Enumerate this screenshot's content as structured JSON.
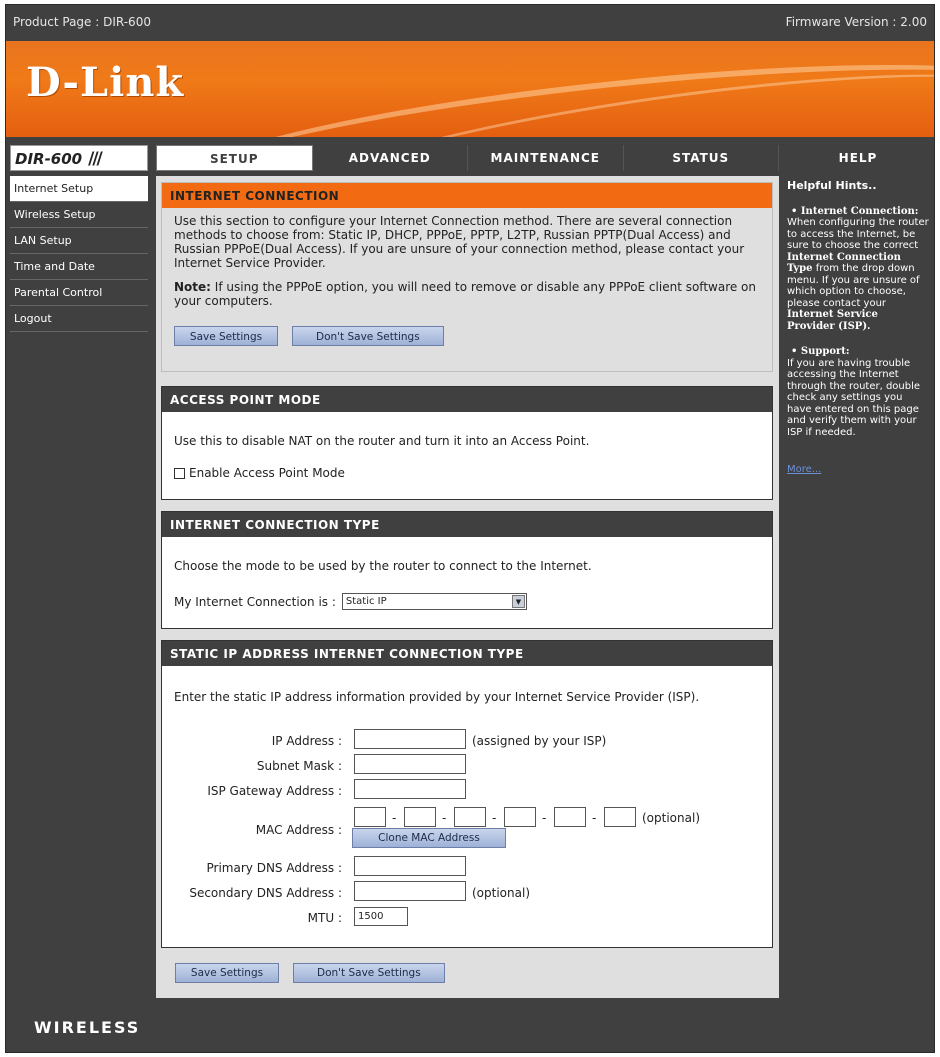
{
  "topbar": {
    "product": "Product Page : DIR-600",
    "firmware": "Firmware Version : 2.00"
  },
  "brand": {
    "logo": "D-Link",
    "model": "DIR-600",
    "model_slashes": "///",
    "footer": "WIRELESS"
  },
  "tabs": [
    "SETUP",
    "ADVANCED",
    "MAINTENANCE",
    "STATUS"
  ],
  "help_tab": "HELP",
  "sidebar": [
    "Internet Setup",
    "Wireless Setup",
    "LAN Setup",
    "Time and Date",
    "Parental Control",
    "Logout"
  ],
  "internet_connection": {
    "title": "INTERNET CONNECTION",
    "desc": "Use this section to configure your Internet Connection method. There are several connection methods to choose from: Static IP, DHCP, PPPoE, PPTP, L2TP, Russian PPTP(Dual Access) and Russian PPPoE(Dual Access). If you are unsure of your connection method, please contact your Internet Service Provider.",
    "note_label": "Note:",
    "note_text": "If using the PPPoE option, you will need to remove or disable any PPPoE client software on your computers."
  },
  "buttons": {
    "save": "Save Settings",
    "dont_save": "Don't Save Settings",
    "clone_mac": "Clone MAC Address"
  },
  "ap_mode": {
    "title": "ACCESS POINT MODE",
    "desc": "Use this to disable NAT on the router and turn it into an Access Point.",
    "checkbox_label": "Enable Access Point Mode"
  },
  "conn_type": {
    "title": "INTERNET CONNECTION TYPE",
    "desc": "Choose the mode to be used by the router to connect to the Internet.",
    "label": "My Internet Connection is :",
    "selected": "Static IP"
  },
  "static_ip": {
    "title": "STATIC IP ADDRESS INTERNET CONNECTION TYPE",
    "desc": "Enter the static IP address information provided by your Internet Service Provider (ISP).",
    "ip_label": "IP Address :",
    "ip_hint": "(assigned by your ISP)",
    "subnet_label": "Subnet Mask :",
    "gateway_label": "ISP Gateway Address :",
    "mac_label": "MAC Address :",
    "mac_sep": "-",
    "mac_hint": "(optional)",
    "dns1_label": "Primary DNS Address :",
    "dns2_label": "Secondary DNS Address :",
    "dns2_hint": "(optional)",
    "mtu_label": "MTU :",
    "mtu_value": "1500"
  },
  "help": {
    "heading": "Helpful Hints..",
    "ic_title": "• Internet Connection:",
    "ic_text1": "When configuring the router to access the Internet, be sure to choose the correct",
    "ic_bold1": "Internet Connection Type",
    "ic_text2": "from the drop down menu. If you are unsure of which option to choose, please contact your",
    "ic_bold2": "Internet Service Provider (ISP).",
    "sup_title": "• Support:",
    "sup_text": "If you are having trouble accessing the Internet through the router, double check any settings you have entered on this page and verify them with your ISP if needed.",
    "more": "More..."
  }
}
